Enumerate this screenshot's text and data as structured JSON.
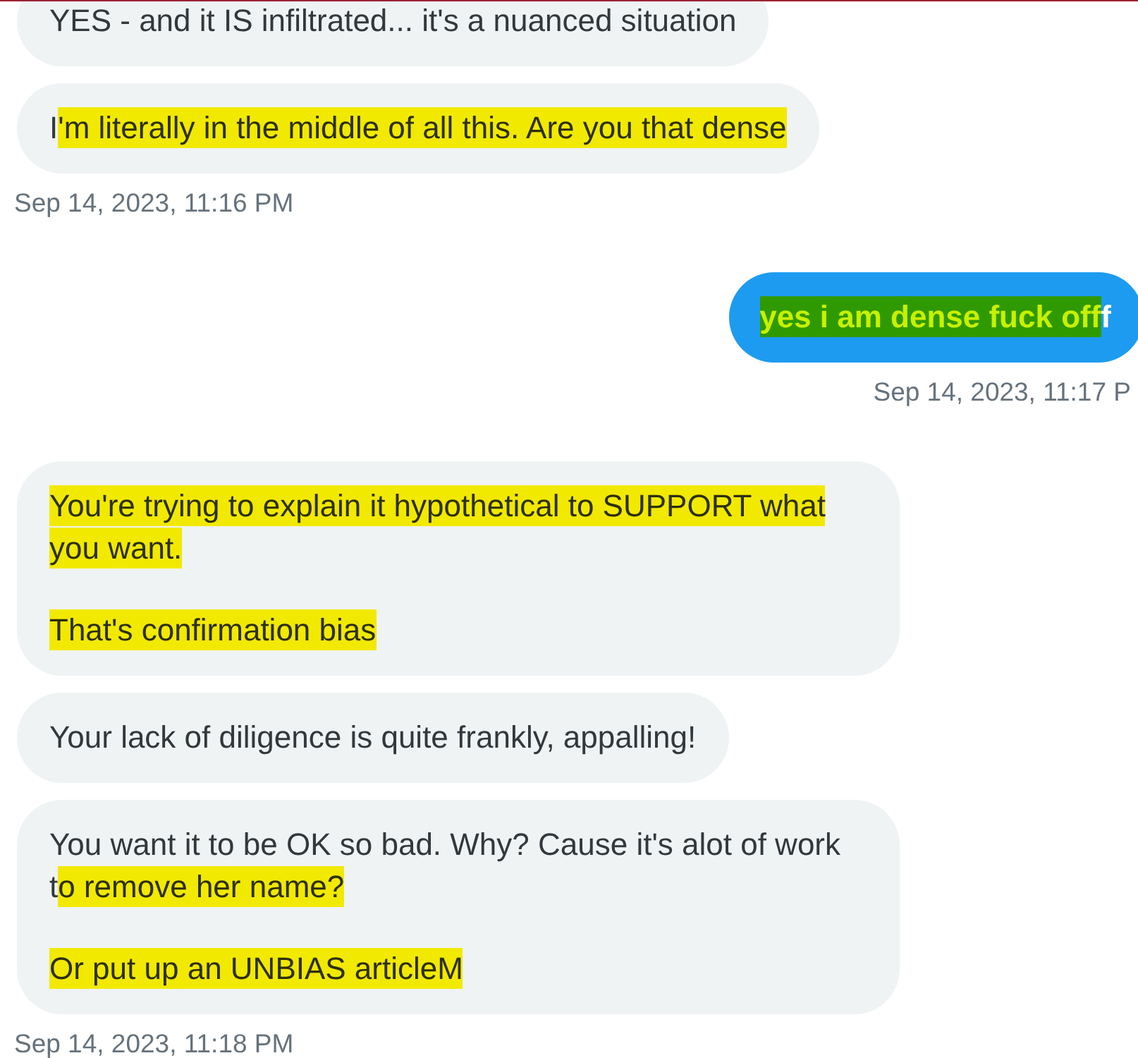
{
  "groups": [
    {
      "kind": "received",
      "messages": [
        {
          "paragraphs": [
            [
              {
                "text": "YES - and it IS infiltrated... it's a nuanced situation",
                "highlighted": false
              }
            ]
          ]
        },
        {
          "paragraphs": [
            [
              {
                "text": "I",
                "highlighted": false
              },
              {
                "text": "'m literally in the middle of all this. Are you that dense",
                "highlighted": true,
                "color": "#f2e900"
              }
            ]
          ]
        }
      ],
      "timestamp": "Sep 14, 2023, 11:16 PM"
    },
    {
      "kind": "sent",
      "messages": [
        {
          "paragraphs": [
            [
              {
                "text": "yes i am dense fuck off",
                "highlighted": true,
                "color": "#2f9a00"
              },
              {
                "text": "f",
                "highlighted": false
              }
            ]
          ]
        }
      ],
      "timestamp": "Sep 14, 2023, 11:17 P"
    },
    {
      "kind": "received",
      "messages": [
        {
          "paragraphs": [
            [
              {
                "text": "You're trying to explain it hypothetical to SUPPORT what you want.",
                "highlighted": true,
                "color": "#f2e900"
              }
            ],
            [
              {
                "text": "That's confirmation bias",
                "highlighted": true,
                "color": "#f2e900"
              }
            ]
          ]
        },
        {
          "paragraphs": [
            [
              {
                "text": "Your lack of diligence is quite frankly, appalling!",
                "highlighted": false
              }
            ]
          ]
        },
        {
          "paragraphs": [
            [
              {
                "text": "You want it to be OK so bad. Why? Cause it's alot of work t",
                "highlighted": false
              },
              {
                "text": "o remove her name?",
                "highlighted": true,
                "color": "#f2e900"
              }
            ],
            [
              {
                "text": "Or put up an UNBIAS articleM",
                "highlighted": true,
                "color": "#f2e900"
              }
            ]
          ]
        }
      ],
      "timestamp": "Sep 14, 2023, 11:18 PM"
    }
  ]
}
